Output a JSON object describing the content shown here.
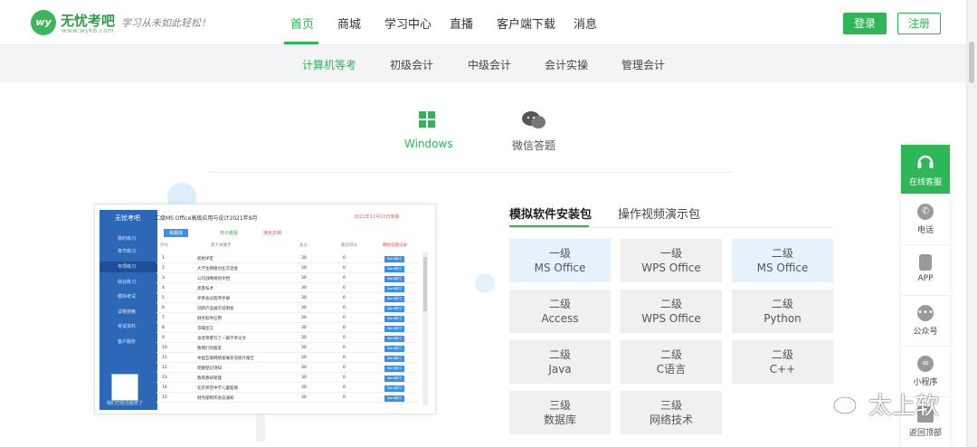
{
  "header": {
    "logo_mark": "wy",
    "brand": "无忧考吧",
    "brand_url": "www.wyk8.com",
    "slogan": "学习从未如此轻松！",
    "nav": [
      "首页",
      "商城",
      "学习中心",
      "直播",
      "客户端下载",
      "消息"
    ],
    "active_nav": "首页",
    "login_label": "登录",
    "register_label": "注册",
    "accent_color": "#2fb657"
  },
  "categories": [
    "计算机等考",
    "初级会计",
    "中级会计",
    "会计实操",
    "管理会计"
  ],
  "active_category": "计算机等考",
  "platforms": [
    {
      "label": "Windows",
      "icon": "windows-icon"
    },
    {
      "label": "微信答题",
      "icon": "wechat-icon"
    }
  ],
  "preview": {
    "logo": "无忧考吧",
    "title": "二级MS Office高级应用与设计2021年9月",
    "date": "2021年11月10日到期",
    "tabs": [
      "练题库",
      "电子教程",
      "演示文档"
    ],
    "menu": [
      "我的练习",
      "章节练习",
      "专项练习",
      "综合练习",
      "模拟考试",
      "试卷搜索",
      "考试资料",
      "客户服务"
    ],
    "active_menu": "专项练习",
    "footer": "我们已经在服务了",
    "columns": [
      "序号",
      "题干关键字",
      "总分",
      "最后得分",
      "模拟答题记录"
    ],
    "rows": [
      {
        "no": "1",
        "topic": "初始评定",
        "total": "30",
        "score": "0",
        "action": "Word练习"
      },
      {
        "no": "2",
        "topic": "大学生网络创业交流会",
        "total": "30",
        "score": "0",
        "action": "Word练习"
      },
      {
        "no": "3",
        "topic": "公司战略规划文档",
        "total": "30",
        "score": "0",
        "action": "Word练习"
      },
      {
        "no": "4",
        "topic": "黑客技术",
        "total": "30",
        "score": "0",
        "action": "Word练习"
      },
      {
        "no": "5",
        "topic": "评审会议程序手册",
        "total": "30",
        "score": "0",
        "action": "Word练习"
      },
      {
        "no": "6",
        "topic": "创新产品展示说明会",
        "total": "30",
        "score": "0",
        "action": "Word练习"
      },
      {
        "no": "7",
        "topic": "财务软件应用",
        "total": "30",
        "score": "0",
        "action": "Word练习"
      },
      {
        "no": "8",
        "topic": "浮躁宣言",
        "total": "30",
        "score": "0",
        "action": "Word练习"
      },
      {
        "no": "9",
        "topic": "张老师撰写了一篇学术论文",
        "total": "30",
        "score": "0",
        "action": "Word练习"
      },
      {
        "no": "10",
        "topic": "致我们的朋友",
        "total": "30",
        "score": "0",
        "action": "Word练习"
      },
      {
        "no": "11",
        "topic": "中国互联网络发展状况统计报告",
        "total": "30",
        "score": "0",
        "action": "Word练习"
      },
      {
        "no": "12",
        "topic": "结婚登记须知",
        "total": "30",
        "score": "0",
        "action": "Word练习"
      },
      {
        "no": "13",
        "topic": "教育教研管理",
        "total": "30",
        "score": "0",
        "action": "Word练习"
      },
      {
        "no": "14",
        "topic": "北京师范中学儿童医保",
        "total": "30",
        "score": "0",
        "action": "Word练习"
      },
      {
        "no": "15",
        "topic": "财务部制作会议通知",
        "total": "30",
        "score": "0",
        "action": "Word练习"
      }
    ]
  },
  "package_tabs": [
    "模拟软件安装包",
    "操作视频演示包"
  ],
  "active_package_tab": "模拟软件安装包",
  "packages": [
    {
      "level": "一级",
      "name": "MS Office",
      "highlight": true
    },
    {
      "level": "一级",
      "name": "WPS Office",
      "highlight": false
    },
    {
      "level": "二级",
      "name": "MS Office",
      "highlight": true
    },
    {
      "level": "二级",
      "name": "Access",
      "highlight": false
    },
    {
      "level": "二级",
      "name": "WPS Office",
      "highlight": false
    },
    {
      "level": "二级",
      "name": "Python",
      "highlight": false
    },
    {
      "level": "二级",
      "name": "Java",
      "highlight": false
    },
    {
      "level": "二级",
      "name": "C语言",
      "highlight": false
    },
    {
      "level": "二级",
      "name": "C++",
      "highlight": false
    },
    {
      "level": "三级",
      "name": "数据库",
      "highlight": false
    },
    {
      "level": "三级",
      "name": "网络技术",
      "highlight": false
    }
  ],
  "side_panel": [
    {
      "label": "在线客服",
      "icon": "headset-icon"
    },
    {
      "label": "电话",
      "icon": "phone-icon"
    },
    {
      "label": "APP",
      "icon": "mobile-icon"
    },
    {
      "label": "公众号",
      "icon": "wechat-icon"
    },
    {
      "label": "小程序",
      "icon": "miniprogram-icon"
    },
    {
      "label": "返回顶部",
      "icon": "arrow-up-icon"
    }
  ],
  "watermark": "太上软"
}
